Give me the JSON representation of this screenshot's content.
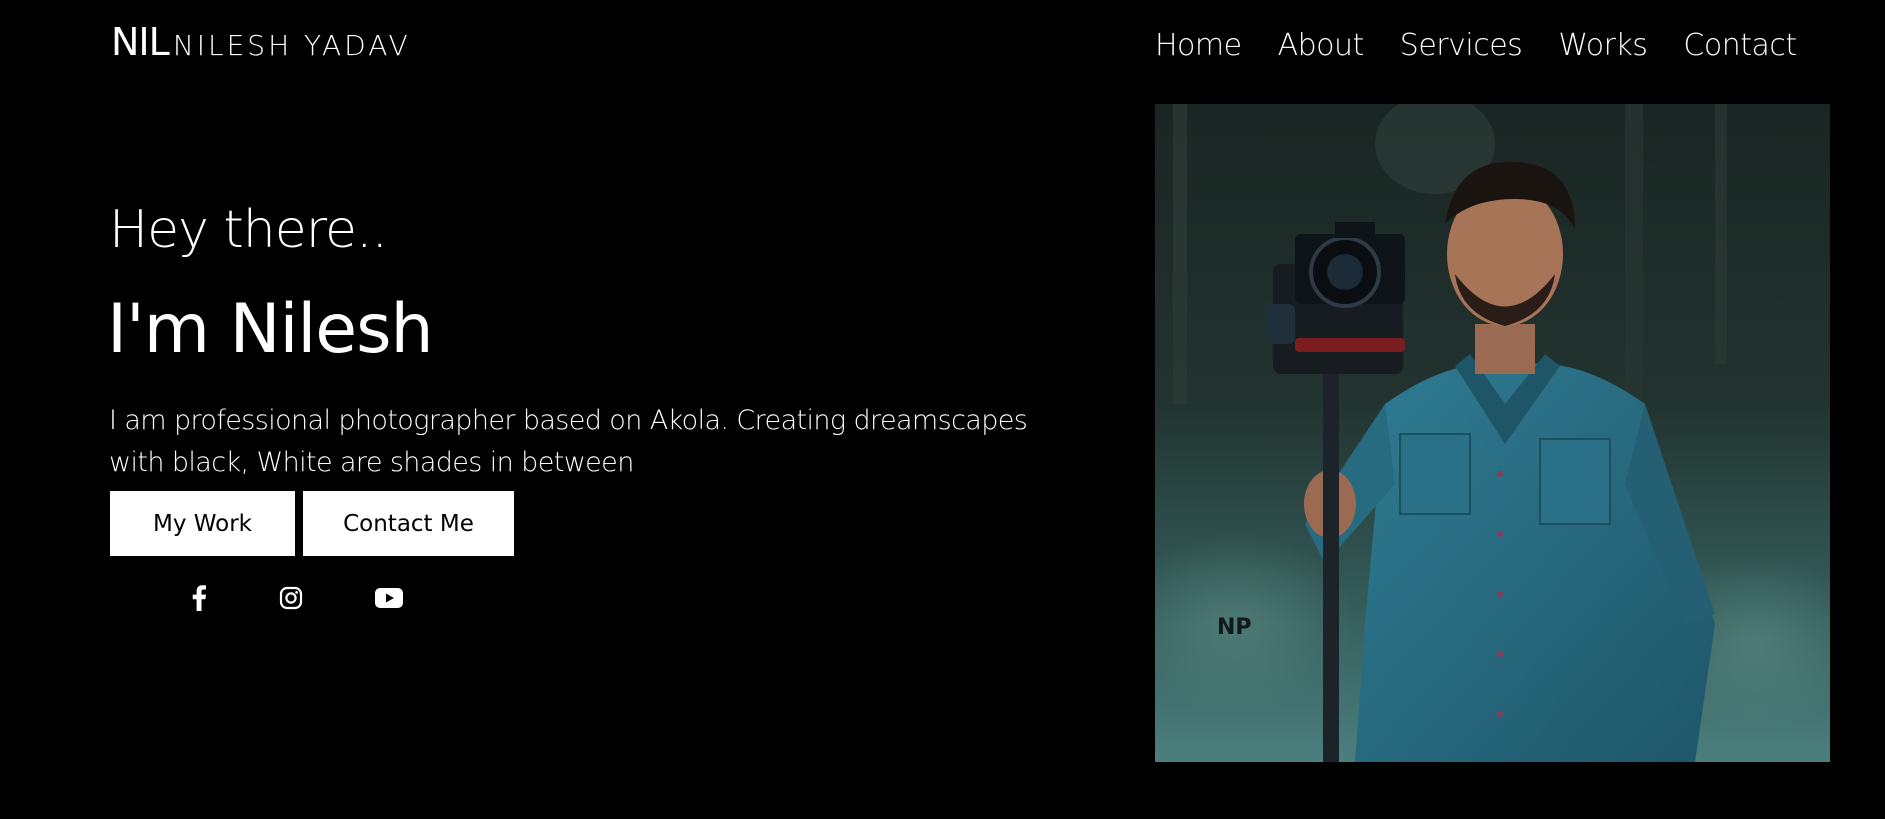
{
  "header": {
    "logo_mark": "NIL",
    "logo_text": "NILESH YADAV"
  },
  "nav": {
    "items": [
      {
        "label": "Home"
      },
      {
        "label": "About"
      },
      {
        "label": "Services"
      },
      {
        "label": "Works"
      },
      {
        "label": "Contact"
      }
    ]
  },
  "hero": {
    "greeting": "Hey there..",
    "headline": "I'm Nilesh",
    "bio": "I am professional photographer based on Akola. Creating dreamscapes with black, White are shades in between",
    "buttons": {
      "work_label": "My Work",
      "contact_label": "Contact Me"
    }
  },
  "social": {
    "icons": [
      "facebook-icon",
      "instagram-icon",
      "youtube-icon"
    ]
  },
  "photo": {
    "subject": "Photographer holding camera on gimbal stabilizer",
    "watermark": "NP"
  },
  "colors": {
    "background": "#000000",
    "text": "#ffffff",
    "button_bg": "#ffffff",
    "button_text": "#000000",
    "shirt": "#2b6f84"
  }
}
